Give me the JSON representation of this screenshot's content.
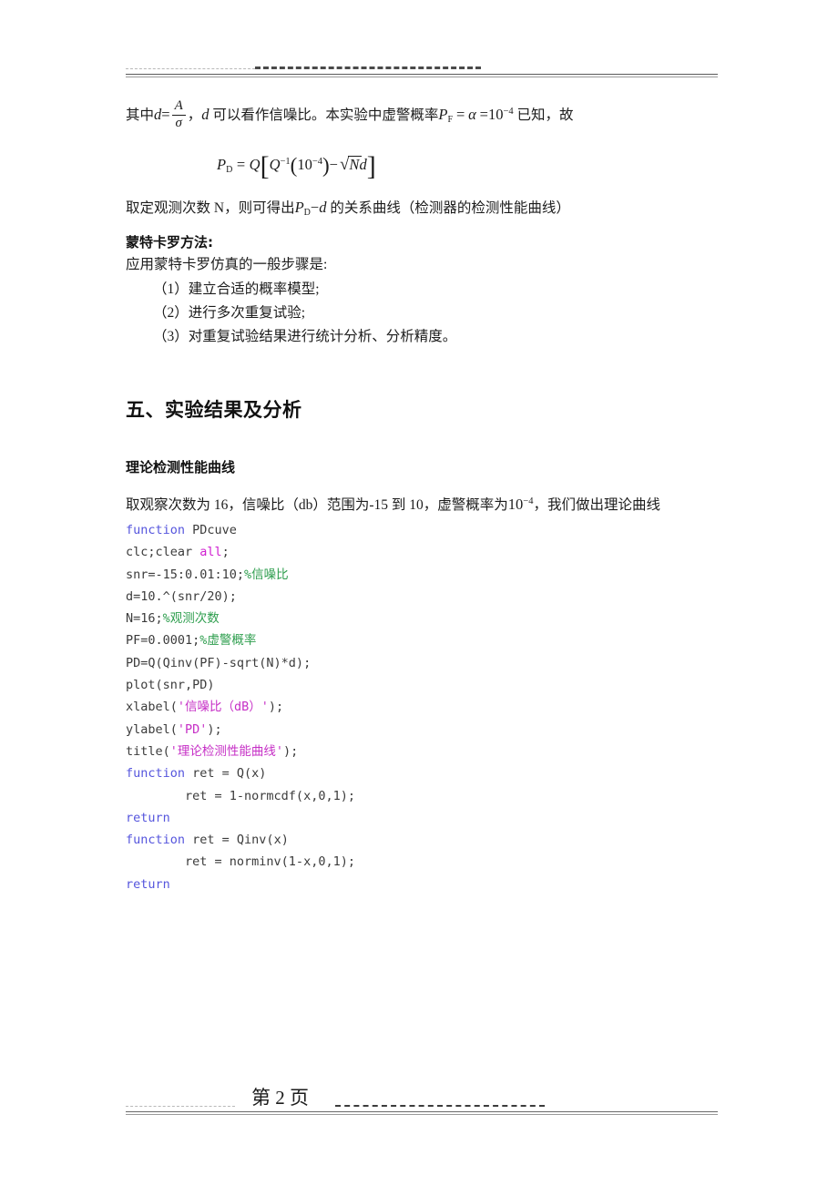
{
  "document": {
    "page_number": "第 2 页",
    "footer_label": "第 2 页"
  },
  "header": {
    "rule": "dashed-header-rule"
  },
  "paragraphs": {
    "p1_prefix": "其中",
    "p1_d": "d",
    "p1_eq": "=",
    "p1_num": "A",
    "p1_den": "σ",
    "p1_mid": "，",
    "p1_d2": "d",
    "p1_text": "可以看作信噪比。本实验中虚警概率",
    "p1_pf": "P",
    "p1_pf_sub": "F",
    "p1_eq2": "=",
    "p1_alpha": "α",
    "p1_eq3": "=",
    "p1_ten": "10",
    "p1_ten_sup": "−4",
    "p1_tail": "已知，故",
    "p2_a": "取定观测次数 N，则可得出",
    "p2_pd": "P",
    "p2_pd_sub": "D",
    "p2_minus": "−",
    "p2_d": "d",
    "p2_b": "的关系曲线（检测器的检测性能曲线）",
    "monte_heading": "蒙特卡罗方法:",
    "monte_intro": "应用蒙特卡罗仿真的一般步骤是:",
    "monte_item1": "（1）建立合适的概率模型;",
    "monte_item2": "（2）进行多次重复试验;",
    "monte_item3": "（3）对重复试验结果进行统计分析、分析精度。",
    "section_five": "五、实验结果及分析",
    "subheading": "理论检测性能曲线",
    "p3_a": "取观察次数为 16，信噪比（db）范围为-15 到 10，虚警概率为",
    "p3_ten": "10",
    "p3_ten_sup": "−4",
    "p3_b": "，我们做出理论曲线"
  },
  "equation": {
    "pd": "P",
    "pd_sub": "D",
    "eq": "=",
    "q": "Q",
    "bracket_open": "[",
    "q2": "Q",
    "q2_sup": "−1",
    "paren_open": "(",
    "ten": "10",
    "ten_sup": "−4",
    "paren_close": ")",
    "minus": "−",
    "sqrt": "√",
    "n": "N",
    "d": "d",
    "bracket_close": "]"
  },
  "code": {
    "language": "matlab",
    "lines": [
      {
        "id": "l1",
        "parts": [
          {
            "t": "function",
            "c": "kw"
          },
          {
            "t": " PDcuve",
            "c": ""
          }
        ]
      },
      {
        "id": "l2",
        "parts": [
          {
            "t": "clc;clear ",
            "c": ""
          },
          {
            "t": "all",
            "c": "kw2"
          },
          {
            "t": ";",
            "c": ""
          }
        ]
      },
      {
        "id": "l3",
        "parts": [
          {
            "t": "snr=-15:0.01:10;",
            "c": ""
          },
          {
            "t": "%信噪比",
            "c": "cmt"
          }
        ]
      },
      {
        "id": "l4",
        "parts": [
          {
            "t": "d=10.^(snr/20);",
            "c": ""
          }
        ]
      },
      {
        "id": "l5",
        "parts": [
          {
            "t": "N=16;",
            "c": ""
          },
          {
            "t": "%观测次数",
            "c": "cmt"
          }
        ]
      },
      {
        "id": "l6",
        "parts": [
          {
            "t": "PF=0.0001;",
            "c": ""
          },
          {
            "t": "%虚警概率",
            "c": "cmt"
          }
        ]
      },
      {
        "id": "l7",
        "parts": [
          {
            "t": "PD=Q(Qinv(PF)-sqrt(N)*d);",
            "c": ""
          }
        ]
      },
      {
        "id": "l8",
        "parts": [
          {
            "t": "plot(snr,PD)",
            "c": ""
          }
        ]
      },
      {
        "id": "l9",
        "parts": [
          {
            "t": "xlabel(",
            "c": ""
          },
          {
            "t": "'信噪比（dB）'",
            "c": "str"
          },
          {
            "t": ");",
            "c": ""
          }
        ]
      },
      {
        "id": "l10",
        "parts": [
          {
            "t": "ylabel(",
            "c": ""
          },
          {
            "t": "'PD'",
            "c": "str"
          },
          {
            "t": ");",
            "c": ""
          }
        ]
      },
      {
        "id": "l11",
        "parts": [
          {
            "t": "title(",
            "c": ""
          },
          {
            "t": "'理论检测性能曲线'",
            "c": "str"
          },
          {
            "t": ");",
            "c": ""
          }
        ]
      },
      {
        "id": "l12",
        "parts": [
          {
            "t": "function",
            "c": "kw"
          },
          {
            "t": " ret = Q(x)",
            "c": ""
          }
        ]
      },
      {
        "id": "l13",
        "parts": [
          {
            "t": "        ret = 1-normcdf(x,0,1);",
            "c": ""
          }
        ]
      },
      {
        "id": "l14",
        "parts": [
          {
            "t": "return",
            "c": "kw"
          }
        ]
      },
      {
        "id": "l15",
        "parts": [
          {
            "t": "function",
            "c": "kw"
          },
          {
            "t": " ret = Qinv(x)",
            "c": ""
          }
        ]
      },
      {
        "id": "l16",
        "parts": [
          {
            "t": "        ret = norminv(1-x,0,1);",
            "c": ""
          }
        ]
      },
      {
        "id": "l17",
        "parts": [
          {
            "t": "return",
            "c": "kw"
          }
        ]
      }
    ]
  },
  "colors": {
    "keyword": "#5555dd",
    "keyword2": "#d020d0",
    "comment": "#2e9e4e",
    "string": "#c62fc6",
    "code_text": "#3b3b3b",
    "body_text": "#1c1c1c",
    "page_bg": "#ffffff"
  }
}
